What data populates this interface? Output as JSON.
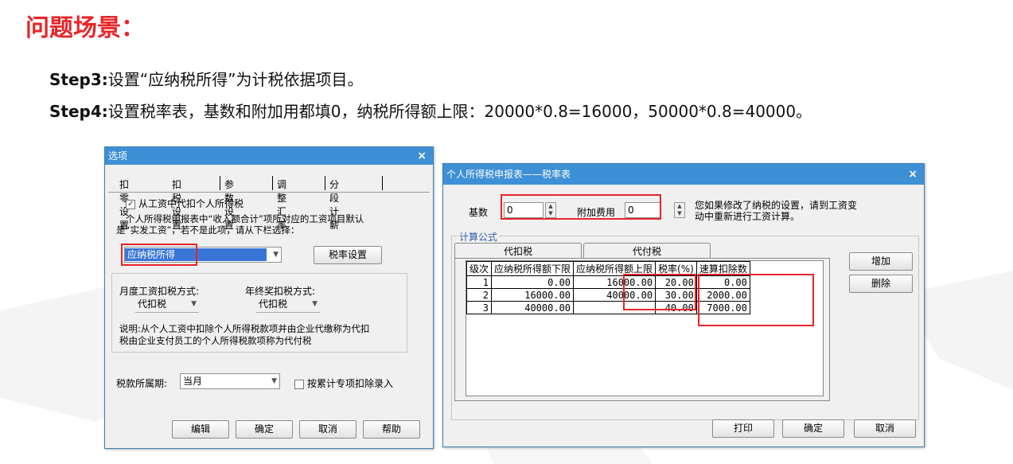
{
  "title": "问题场景：",
  "steps": {
    "step3_label": "Step3:",
    "step3_text": "设置“应纳税所得”为计税依据项目。",
    "step4_label": "Step4:",
    "step4_text": "设置税率表，基数和附加用都填0，纳税所得额上限：20000*0.8=16000，50000*0.8=40000。"
  },
  "options_dialog": {
    "title": "选项",
    "close": "×",
    "tabs": [
      "扣零设置",
      "扣税设置",
      "参数设置",
      "调整汇率",
      "分段计薪"
    ],
    "checkbox_label": "从工资中代扣个人所得税",
    "desc_line1": "个人所得税申报表中“收入额合计”项所对应的工资项目默认",
    "desc_line2": "是“实发工资”，若不是此项，请从下栏选择：",
    "selected_item": "应纳税所得",
    "tax_rate_button": "税率设置",
    "monthly_label": "月度工资扣税方式:",
    "monthly_value": "代扣税",
    "annual_label": "年终奖扣税方式:",
    "annual_value": "代扣税",
    "explain_line1": "说明:从个人工资中扣除个人所得税款项并由企业代缴称为代扣",
    "explain_line2": "税由企业支付员工的个人所得税款项称为代付税",
    "period_label": "税款所属期:",
    "period_value": "当月",
    "cumulative_label": "按累计专项扣除录入",
    "buttons": [
      "编辑",
      "确定",
      "取消",
      "帮助"
    ]
  },
  "rate_dialog": {
    "title": "个人所得税申报表——税率表",
    "close": "×",
    "base_label": "基数",
    "base_value": "0",
    "extra_label": "附加费用",
    "extra_value": "0",
    "note_line1": "您如果修改了纳税的设置，请到工资变",
    "note_line2": "动中重新进行工资计算。",
    "group_label": "计算公式",
    "tabs": [
      "代扣税",
      "代付税"
    ],
    "columns": [
      "级次",
      "应纳税所得额下限",
      "应纳税所得额上限",
      "税率(%)",
      "速算扣除数"
    ],
    "rows": [
      [
        "1",
        "0.00",
        "16000.00",
        "20.00",
        "0.00"
      ],
      [
        "2",
        "16000.00",
        "40000.00",
        "30.00",
        "2000.00"
      ],
      [
        "3",
        "40000.00",
        "",
        "40.00",
        "7000.00"
      ]
    ],
    "side_buttons": [
      "增加",
      "删除"
    ],
    "bottom_buttons": [
      "打印",
      "确定",
      "取消"
    ]
  },
  "colors": {
    "title_red": "#e8262a",
    "titlebar_blue": "#3d8fd6",
    "highlight_red": "#e8262a",
    "selection_blue": "#3875d7"
  }
}
